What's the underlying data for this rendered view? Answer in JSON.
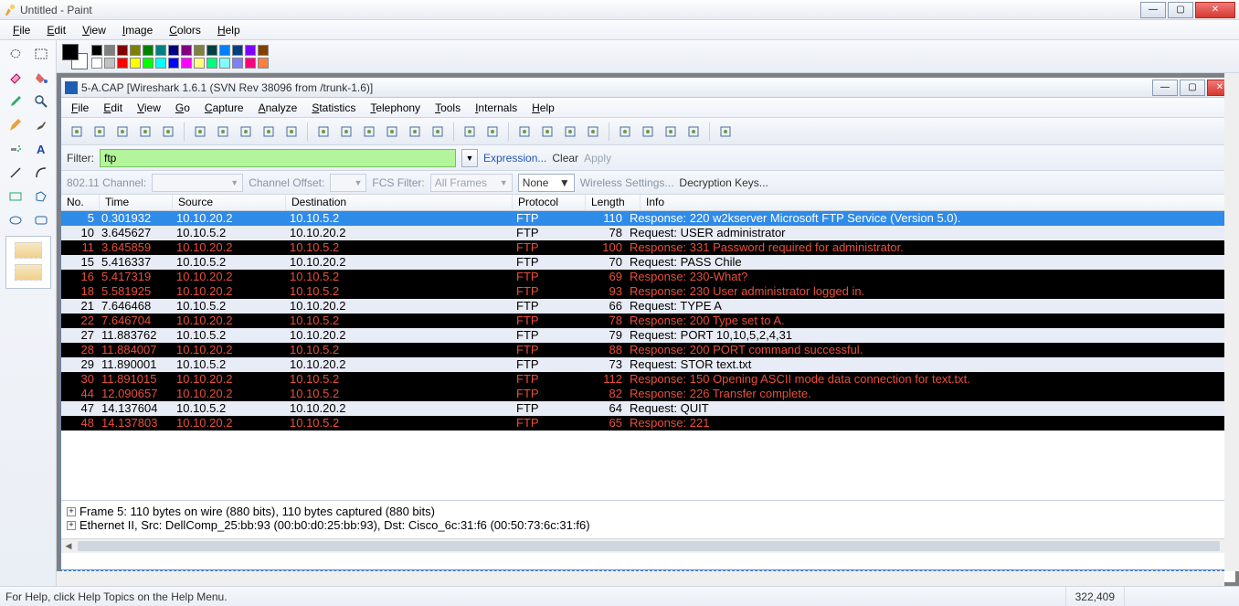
{
  "paint": {
    "title": "Untitled - Paint",
    "menu": [
      "File",
      "Edit",
      "View",
      "Image",
      "Colors",
      "Help"
    ],
    "status_help": "For Help, click Help Topics on the Help Menu.",
    "status_coords": "322,409",
    "palette_colors_row1": [
      "#000000",
      "#808080",
      "#800000",
      "#808000",
      "#008000",
      "#008080",
      "#000080",
      "#800080",
      "#808040",
      "#004040",
      "#0080ff",
      "#004080",
      "#8000ff",
      "#804000"
    ],
    "palette_colors_row2": [
      "#ffffff",
      "#c0c0c0",
      "#ff0000",
      "#ffff00",
      "#00ff00",
      "#00ffff",
      "#0000ff",
      "#ff00ff",
      "#ffff80",
      "#00ff80",
      "#80ffff",
      "#8080ff",
      "#ff0080",
      "#ff8040"
    ]
  },
  "wireshark": {
    "title": "5-A.CAP   [Wireshark 1.6.1  (SVN Rev 38096 from /trunk-1.6)]",
    "menu": [
      "File",
      "Edit",
      "View",
      "Go",
      "Capture",
      "Analyze",
      "Statistics",
      "Telephony",
      "Tools",
      "Internals",
      "Help"
    ],
    "filter_label": "Filter:",
    "filter_value": "ftp",
    "expression": "Expression...",
    "clear": "Clear",
    "apply": "Apply",
    "wlan": {
      "channel_label": "802.11 Channel:",
      "offset_label": "Channel Offset:",
      "fcs_label": "FCS Filter:",
      "fcs_value": "All Frames",
      "none": "None",
      "wireless_settings": "Wireless Settings...",
      "decryption_keys": "Decryption Keys..."
    },
    "columns": {
      "no": "No.",
      "time": "Time",
      "src": "Source",
      "dst": "Destination",
      "proto": "Protocol",
      "len": "Length",
      "info": "Info"
    },
    "packets": [
      {
        "no": "5",
        "time": "0.301932",
        "src": "10.10.20.2",
        "dst": "10.10.5.2",
        "proto": "FTP",
        "len": "110",
        "info": "Response: 220 w2kserver Microsoft FTP Service (Version 5.0).",
        "style": "sel"
      },
      {
        "no": "10",
        "time": "3.645627",
        "src": "10.10.5.2",
        "dst": "10.10.20.2",
        "proto": "FTP",
        "len": "78",
        "info": "Request: USER administrator",
        "style": "light"
      },
      {
        "no": "11",
        "time": "3.645859",
        "src": "10.10.20.2",
        "dst": "10.10.5.2",
        "proto": "FTP",
        "len": "100",
        "info": "Response: 331 Password required for administrator.",
        "style": "dark"
      },
      {
        "no": "15",
        "time": "5.416337",
        "src": "10.10.5.2",
        "dst": "10.10.20.2",
        "proto": "FTP",
        "len": "70",
        "info": "Request: PASS Chile",
        "style": "light"
      },
      {
        "no": "16",
        "time": "5.417319",
        "src": "10.10.20.2",
        "dst": "10.10.5.2",
        "proto": "FTP",
        "len": "69",
        "info": "Response: 230-What?",
        "style": "dark"
      },
      {
        "no": "18",
        "time": "5.581925",
        "src": "10.10.20.2",
        "dst": "10.10.5.2",
        "proto": "FTP",
        "len": "93",
        "info": "Response: 230 User administrator logged in.",
        "style": "dark"
      },
      {
        "no": "21",
        "time": "7.646468",
        "src": "10.10.5.2",
        "dst": "10.10.20.2",
        "proto": "FTP",
        "len": "66",
        "info": "Request: TYPE A",
        "style": "light"
      },
      {
        "no": "22",
        "time": "7.646704",
        "src": "10.10.20.2",
        "dst": "10.10.5.2",
        "proto": "FTP",
        "len": "78",
        "info": "Response: 200 Type set to A.",
        "style": "dark"
      },
      {
        "no": "27",
        "time": "11.883762",
        "src": "10.10.5.2",
        "dst": "10.10.20.2",
        "proto": "FTP",
        "len": "79",
        "info": "Request: PORT 10,10,5,2,4,31",
        "style": "light"
      },
      {
        "no": "28",
        "time": "11.884007",
        "src": "10.10.20.2",
        "dst": "10.10.5.2",
        "proto": "FTP",
        "len": "88",
        "info": "Response: 200 PORT command successful.",
        "style": "dark"
      },
      {
        "no": "29",
        "time": "11.890001",
        "src": "10.10.5.2",
        "dst": "10.10.20.2",
        "proto": "FTP",
        "len": "73",
        "info": "Request: STOR text.txt",
        "style": "light"
      },
      {
        "no": "30",
        "time": "11.891015",
        "src": "10.10.20.2",
        "dst": "10.10.5.2",
        "proto": "FTP",
        "len": "112",
        "info": "Response: 150 Opening ASCII mode data connection for text.txt.",
        "style": "dark"
      },
      {
        "no": "44",
        "time": "12.090657",
        "src": "10.10.20.2",
        "dst": "10.10.5.2",
        "proto": "FTP",
        "len": "82",
        "info": "Response: 226 Transfer complete.",
        "style": "dark"
      },
      {
        "no": "47",
        "time": "14.137604",
        "src": "10.10.5.2",
        "dst": "10.10.20.2",
        "proto": "FTP",
        "len": "64",
        "info": "Request: QUIT",
        "style": "light"
      },
      {
        "no": "48",
        "time": "14.137803",
        "src": "10.10.20.2",
        "dst": "10.10.5.2",
        "proto": "FTP",
        "len": "65",
        "info": "Response: 221",
        "style": "dark"
      }
    ],
    "tree": {
      "line1": "Frame 5: 110 bytes on wire (880 bits), 110 bytes captured (880 bits)",
      "line2": "Ethernet II, Src: DellComp_25:bb:93 (00:b0:d0:25:bb:93), Dst: Cisco_6c:31:f6 (00:50:73:6c:31:f6)"
    }
  }
}
